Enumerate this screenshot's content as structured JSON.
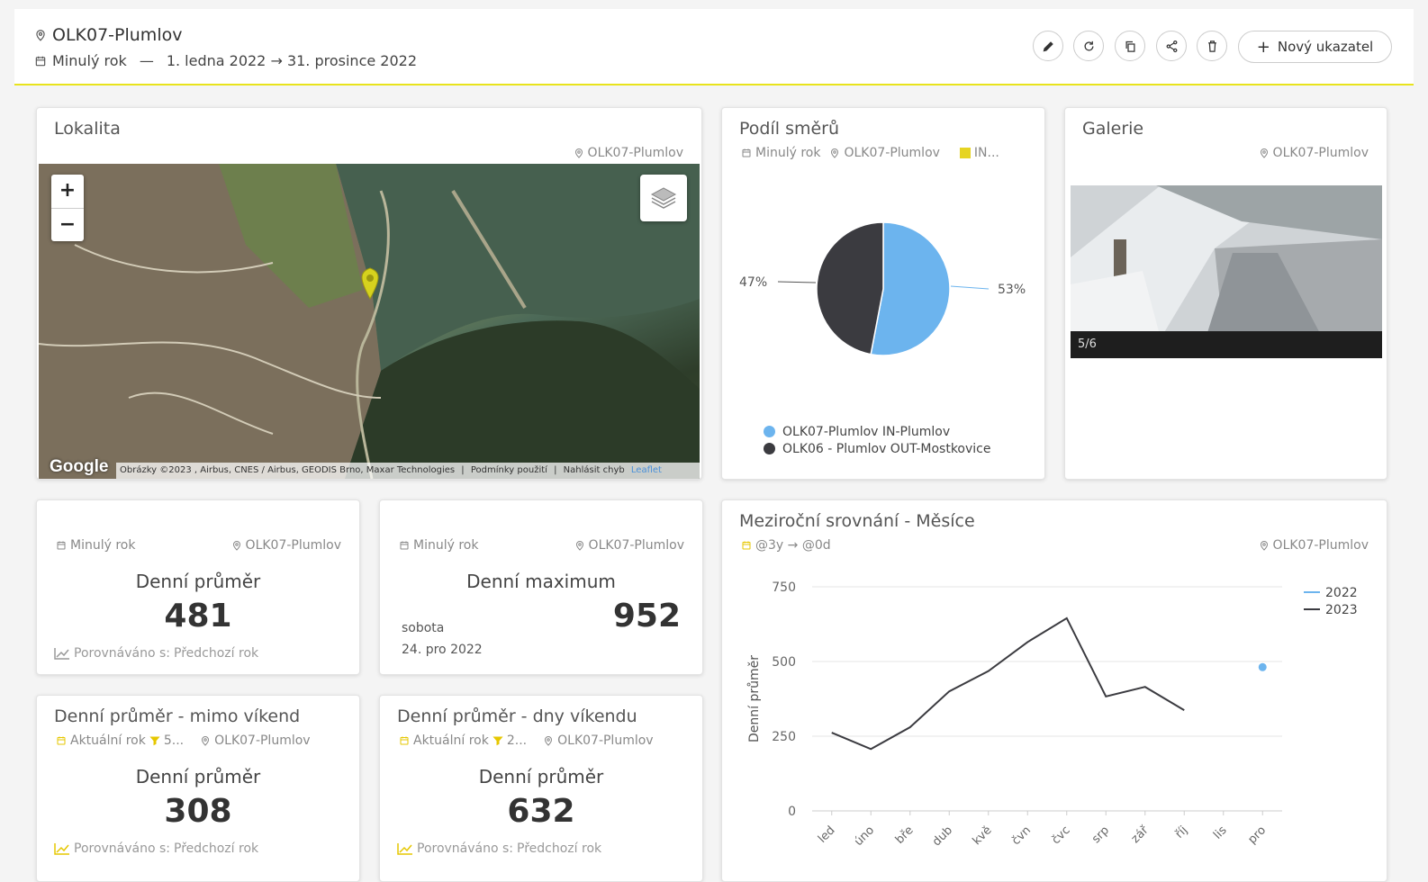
{
  "header": {
    "title": "OLK07-Plumlov",
    "period_label": "Minulý rok",
    "separator": "—",
    "date_range": "1. ledna 2022 → 31. prosince 2022",
    "new_indicator_label": "Nový ukazatel",
    "toolbar_icons": [
      "pencil-icon",
      "refresh-icon",
      "copy-icon",
      "share-icon",
      "trash-icon"
    ]
  },
  "colors": {
    "accent_yellow": "#e8e31c",
    "series_blue": "#6cb4ee",
    "series_dark": "#3b3b40"
  },
  "lokalita": {
    "title": "Lokalita",
    "location": "OLK07-Plumlov",
    "zoom_in": "+",
    "zoom_out": "−",
    "google": "Google",
    "attribution": "Obrázky ©2023 , Airbus, CNES / Airbus, GEODIS Brno, Maxar Technologies",
    "terms": "Podmínky použití",
    "report": "Nahlásit chyb",
    "leaflet": "Leaflet"
  },
  "podil": {
    "title": "Podíl směrů",
    "period": "Minulý rok",
    "location": "OLK07-Plumlov",
    "tag": "IN...",
    "pct_left": "47%",
    "pct_right": "53%",
    "legend": [
      {
        "label": "OLK07-Plumlov IN-Plumlov",
        "color": "#6cb4ee"
      },
      {
        "label": "OLK06 - Plumlov OUT-Mostkovice",
        "color": "#3b3b40"
      }
    ]
  },
  "galerie": {
    "title": "Galerie",
    "location": "OLK07-Plumlov",
    "counter": "5/6"
  },
  "kpi_prumer": {
    "period": "Minulý rok",
    "location": "OLK07-Plumlov",
    "label": "Denní průměr",
    "value": "481",
    "compare": "Porovnáváno s:",
    "compare_target": "Předchozí rok"
  },
  "kpi_maximum": {
    "period": "Minulý rok",
    "location": "OLK07-Plumlov",
    "label": "Denní maximum",
    "value": "952",
    "day": "sobota",
    "date": "24. pro 2022"
  },
  "kpi_mimo": {
    "title": "Denní průměr - mimo víkend",
    "period": "Aktuální rok",
    "filter": "5...",
    "location": "OLK07-Plumlov",
    "label": "Denní průměr",
    "value": "308",
    "compare": "Porovnáváno s:",
    "compare_target": "Předchozí rok"
  },
  "kpi_vikend": {
    "title": "Denní průměr - dny víkendu",
    "period": "Aktuální rok",
    "filter": "2...",
    "location": "OLK07-Plumlov",
    "label": "Denní průměr",
    "value": "632",
    "compare": "Porovnáváno s:",
    "compare_target": "Předchozí rok"
  },
  "mezirocni": {
    "title": "Meziroční srovnání - Měsíce",
    "period": "@3y → @0d",
    "location": "OLK07-Plumlov"
  },
  "chart_data": [
    {
      "type": "pie",
      "title": "Podíl směrů",
      "labels": [
        "OLK07-Plumlov IN-Plumlov",
        "OLK06 - Plumlov OUT-Mostkovice"
      ],
      "values": [
        53,
        47
      ]
    },
    {
      "type": "line",
      "title": "Meziroční srovnání - Měsíce",
      "ylabel": "Denní průměr",
      "xlabel": "",
      "ylim": [
        0,
        750
      ],
      "yticks": [
        0,
        250,
        500,
        750
      ],
      "categories": [
        "led",
        "úno",
        "bře",
        "dub",
        "kvě",
        "čvn",
        "čvc",
        "srp",
        "zář",
        "říj",
        "lis",
        "pro"
      ],
      "legend_position": "top-right",
      "grid": true,
      "series": [
        {
          "name": "2022",
          "color": "#6cb4ee",
          "values": [
            null,
            null,
            null,
            null,
            null,
            null,
            null,
            null,
            null,
            null,
            null,
            481
          ]
        },
        {
          "name": "2023",
          "color": "#3b3b40",
          "values": [
            262,
            207,
            280,
            400,
            468,
            565,
            645,
            383,
            415,
            337,
            null,
            null
          ]
        }
      ]
    }
  ]
}
